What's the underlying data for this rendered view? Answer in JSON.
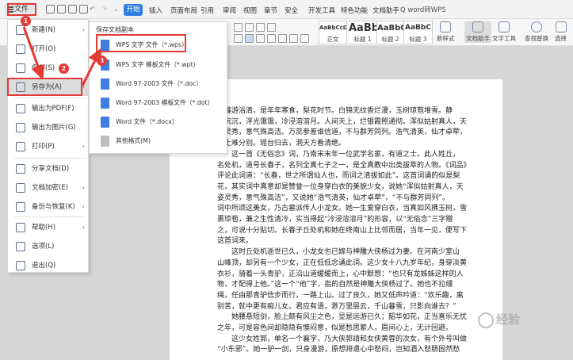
{
  "topbar": {
    "file_label": "文件",
    "tabs": [
      "开始",
      "插入",
      "页面布局",
      "引用",
      "审阅",
      "视图",
      "章节",
      "安全",
      "开发工具",
      "特色功能",
      "文档助手"
    ],
    "search_label": "Q word转WPS"
  },
  "ribbon": {
    "styles": [
      {
        "preview": "AaBbCcDd",
        "caption": "正文"
      },
      {
        "preview": "AaBb",
        "caption": "标题 1"
      },
      {
        "preview": "AaBbC",
        "caption": "标题 2"
      },
      {
        "preview": "AaBbC",
        "caption": "标题 3"
      }
    ],
    "new_style_label": "新样式",
    "doc_assistant_label": "文档助手",
    "text_tools_label": "文字工具",
    "find_replace_label": "查找替换",
    "select_label": "选择"
  },
  "file_menu": {
    "items": [
      {
        "label": "新建(N)",
        "icon": "new-doc-icon",
        "arrow": true
      },
      {
        "label": "打开(O)",
        "icon": "folder-icon",
        "arrow": false
      },
      {
        "label": "保存(S)",
        "icon": "save-icon",
        "arrow": false
      },
      {
        "label": "另存为(A)",
        "icon": "save-as-icon",
        "arrow": true
      },
      {
        "label": "输出为PDF(F)",
        "icon": "pdf-icon",
        "arrow": false
      },
      {
        "label": "输出为图片(G)",
        "icon": "image-icon",
        "arrow": false
      },
      {
        "label": "打印(P)",
        "icon": "print-icon",
        "arrow": true
      },
      {
        "label": "分享文档(D)",
        "icon": "share-icon",
        "arrow": false
      },
      {
        "label": "文档加密(E)",
        "icon": "lock-icon",
        "arrow": true
      },
      {
        "label": "备份与恢复(K)",
        "icon": "backup-icon",
        "arrow": true
      },
      {
        "label": "帮助(H)",
        "icon": "help-icon",
        "arrow": true
      },
      {
        "label": "选项(L)",
        "icon": "gear-icon",
        "arrow": false
      },
      {
        "label": "退出(Q)",
        "icon": "exit-icon",
        "arrow": false
      }
    ]
  },
  "submenu": {
    "title": "保存文档副本",
    "items": [
      {
        "label": "WPS 文字 文件（*.wps）",
        "icon": "wps-doc-icon"
      },
      {
        "label": "WPS 文字 模板文件（*.wpt）",
        "icon": "wps-template-icon"
      },
      {
        "label": "Word 97-2003 文件（*.doc）",
        "icon": "word-doc-icon"
      },
      {
        "label": "Word 97-2003 模板文件（*.dot）",
        "icon": "word-template-icon"
      },
      {
        "label": "Word 文件（*.docx）",
        "icon": "word-docx-icon"
      },
      {
        "label": "其他格式(M)",
        "icon": "other-format-icon"
      }
    ]
  },
  "annotations": {
    "badges": [
      "1",
      "2",
      "3"
    ],
    "highlight_color": "#e53935"
  },
  "document": {
    "lines": [
      "春暮游浴清，是年年寒食，梨花时节。白锦无纹香烂漫，玉树琼苞堆雪。静",
      "夜沉沉，浮光霭霭，冷浸溶溶月。人间天上，烂银霞照通彻。浑似姑射真人，天",
      "姿灵秀，意气殊高洁。万蕊参差谁信道，不与群芳同列。浩气清英，仙才卓荦，",
      "下土难分别。瑶台归去，洞天方看清绝。",
      "　　这一首《无俗念》词，乃南宋末年一位武学名家，有道之士。此人姓丘，",
      "名处机，道号长春子，名列全真七子之一，是全真教中出类拔萃的人物。《词品》",
      "评论此词道：“长春，世之所谓仙人也，而词之清拔如此”。这首词诵的似是梨",
      "花，其实词中真意却是赞誉一位身穿白衣的美貌少女，说她“浑似姑射真人，天",
      "姿灵秀，意气殊高洁”，又说她“浩气清英，仙才卓荦”，“不与群芳同列”。",
      "词中所颂这美女，乃古墓派传人小龙女。她一生爱穿白衣，当真如风拂玉树，雪",
      "裹琼苞，兼之生性清冷，实当得起“冷浸溶溶月”的形容，以“无俗念”三字赠",
      "之，可说十分贴切。长春子丘处机和她在终南山上比邻而居，当年一见，便写下",
      "这首词来。",
      "　　这时丘处机逝世已久，小龙女也已嫁与神雕大侠杨过为妻。在河南少室山",
      "山峰顶，却另有一个少女，正在低低念诵此词。这少女十八九岁年纪，身穿淡黄",
      "衣衫，骑着一头青驴，正沿山道缓缓而上，心中默想：“也只有龙姊姊这样的人",
      "物，才配得上他。”这一个“他”字，指的自然是神雕大侠杨过了。她也不拉缰",
      "绳，任由那青驴信步而行，一路上山。过了良久，她又低声吟道：“欢乐趣，离",
      "别苦，就中更有痴儿女。君应有语，渺万里层云，千山暮雪，只影向谁去？”",
      "　　她腰悬短剑，脸上颇有风尘之色，显是远游已久；韶华如花，正当喜乐无忧",
      "之年，可是容色间却隐隐有懊闷意，似是愁思萦人，眉间心上，无计回避。",
      "　　这少女姓郭，单名一个襄字，乃大侠郭靖和女侠黄蓉的次女，有个外号叫做",
      "“小东邪”。她一驴一剑，只身漫游，原想排遣心中愁闷，岂知酒入愁肠固然愁"
    ]
  },
  "watermark": "经验"
}
